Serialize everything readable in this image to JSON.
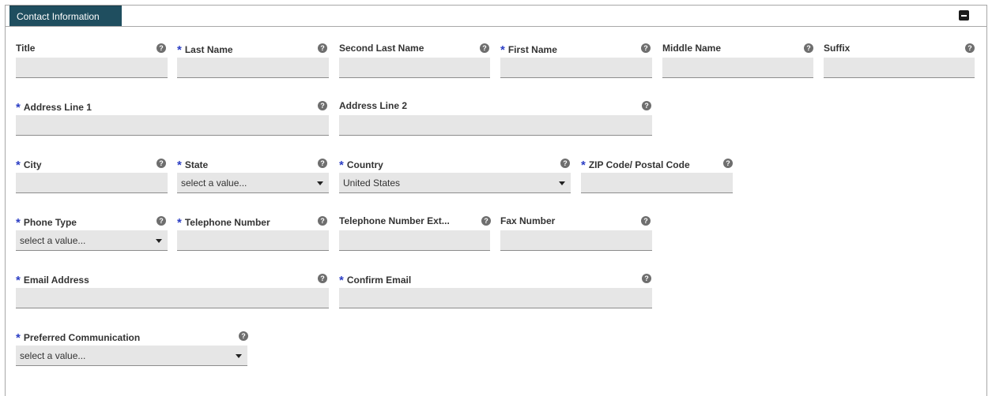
{
  "section": {
    "title": "Contact Information",
    "collapse_icon": "minus-square-icon"
  },
  "help_glyph": "?",
  "req_glyph": "*",
  "fields": {
    "title": {
      "label": "Title"
    },
    "last_name": {
      "label": "Last Name"
    },
    "second_last_name": {
      "label": "Second Last Name"
    },
    "first_name": {
      "label": "First Name"
    },
    "middle_name": {
      "label": "Middle Name"
    },
    "suffix": {
      "label": "Suffix"
    },
    "address1": {
      "label": "Address Line 1"
    },
    "address2": {
      "label": "Address Line 2"
    },
    "city": {
      "label": "City"
    },
    "state": {
      "label": "State",
      "value": "select a value..."
    },
    "country": {
      "label": "Country",
      "value": "United States"
    },
    "zip": {
      "label": "ZIP Code/ Postal Code"
    },
    "phone_type": {
      "label": "Phone Type",
      "value": "select a value..."
    },
    "telephone": {
      "label": "Telephone Number"
    },
    "telephone_ext": {
      "label": "Telephone Number Ext..."
    },
    "fax": {
      "label": "Fax Number"
    },
    "email": {
      "label": "Email Address"
    },
    "confirm_email": {
      "label": "Confirm Email"
    },
    "preferred_comm": {
      "label": "Preferred Communication",
      "value": "select a value..."
    }
  }
}
